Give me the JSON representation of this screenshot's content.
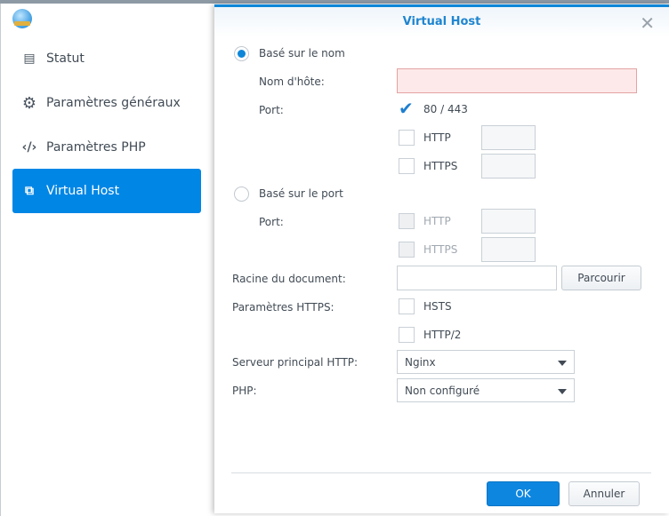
{
  "sidebar": {
    "items": [
      {
        "label": "Statut",
        "icon": "id-card-icon"
      },
      {
        "label": "Paramètres généraux",
        "icon": "gear-icon"
      },
      {
        "label": "Paramètres PHP",
        "icon": "code-icon"
      },
      {
        "label": "Virtual Host",
        "icon": "virtual-host-icon",
        "active": true
      }
    ]
  },
  "dialog": {
    "title": "Virtual Host",
    "name_based": {
      "label": "Basé sur le nom",
      "selected": true,
      "hostname_label": "Nom d'hôte:",
      "hostname_value": "",
      "port_label": "Port:",
      "ports": [
        {
          "label": "80 / 443",
          "checked": true
        },
        {
          "label": "HTTP",
          "checked": false,
          "value": ""
        },
        {
          "label": "HTTPS",
          "checked": false,
          "value": ""
        }
      ]
    },
    "port_based": {
      "label": "Basé sur le port",
      "selected": false,
      "port_label": "Port:",
      "ports": [
        {
          "label": "HTTP",
          "disabled": true,
          "value": ""
        },
        {
          "label": "HTTPS",
          "disabled": true,
          "value": ""
        }
      ]
    },
    "doc_root": {
      "label": "Racine du document:",
      "value": "",
      "browse": "Parcourir"
    },
    "https": {
      "label": "Paramètres HTTPS:",
      "options": [
        {
          "label": "HSTS",
          "checked": false
        },
        {
          "label": "HTTP/2",
          "checked": false
        }
      ]
    },
    "backend": {
      "label": "Serveur principal HTTP:",
      "value": "Nginx"
    },
    "php": {
      "label": "PHP:",
      "value": "Non configuré"
    },
    "ok": "OK",
    "cancel": "Annuler"
  },
  "colors": {
    "accent": "#0086e5",
    "error_bg": "#fde9e9"
  }
}
